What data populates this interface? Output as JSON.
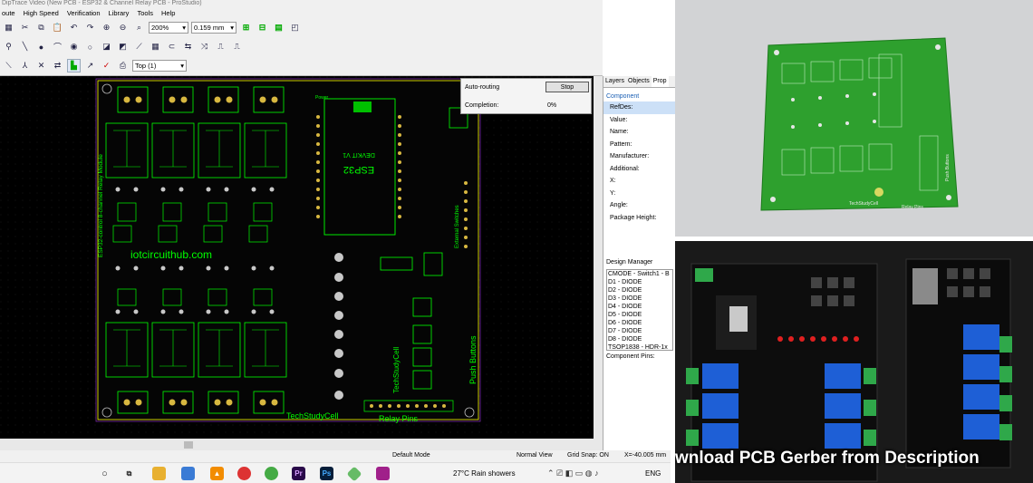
{
  "window": {
    "title": "DipTrace Video (New PCB - ESP32 & Channel Relay PCB - ProStudio)"
  },
  "menu": [
    "oute",
    "High Speed",
    "Verification",
    "Library",
    "Tools",
    "Help"
  ],
  "toolbar": {
    "zoom": "200%",
    "grid": "0.159 mm",
    "layer": "Top (1)"
  },
  "autorouting": {
    "title": "Auto-routing",
    "stop": "Stop",
    "completion_label": "Completion:",
    "completion_value": "0%"
  },
  "panel": {
    "tabs": [
      "Layers",
      "Objects",
      "Prop"
    ],
    "section": "Component",
    "props": [
      "RefDes:",
      "Value:",
      "Name:",
      "Pattern:",
      "Manufacturer:",
      "Additional:",
      "X:",
      "Y:",
      "Angle:",
      "Package Height:"
    ],
    "design_manager": "Design Manager",
    "dm_items": [
      "CMODE - Switch1 - B",
      "D1 - DIODE",
      "D2 - DIODE",
      "D3 - DIODE",
      "D4 - DIODE",
      "D5 - DIODE",
      "D6 - DIODE",
      "D7 - DIODE",
      "D8 - DIODE",
      "TSOP1838 - HDR-1x"
    ],
    "component_pins": "Component Pins:"
  },
  "board": {
    "module_title": "ESP32-control 8-channel Relay Module",
    "website": "iotcircuithub.com",
    "chip": "ESP32",
    "devkit": "DEVKIT V1",
    "push": "Push Buttons",
    "external": "External Switches",
    "studio": "TechStudyCell",
    "relay_pins": "Relay Pins",
    "power": "Power"
  },
  "status": {
    "mode": "Default Mode",
    "view": "Normal View",
    "snap": "Grid Snap: ON",
    "x": "X=-40.005 mm"
  },
  "taskbar": {
    "weather": "27°C Rain showers",
    "lang": "ENG"
  },
  "video": {
    "caption": "wnload PCB Gerber from Description",
    "board_label": "TechStudyCell",
    "board_label2": "Relay Pins",
    "board_label3": "Push Buttons"
  },
  "colors": {
    "pcb_green": "#2e9e2e",
    "silk": "#f0f000",
    "copper": "#b8a030",
    "canvas": "#000000",
    "panel_select": "#cce0f7"
  }
}
